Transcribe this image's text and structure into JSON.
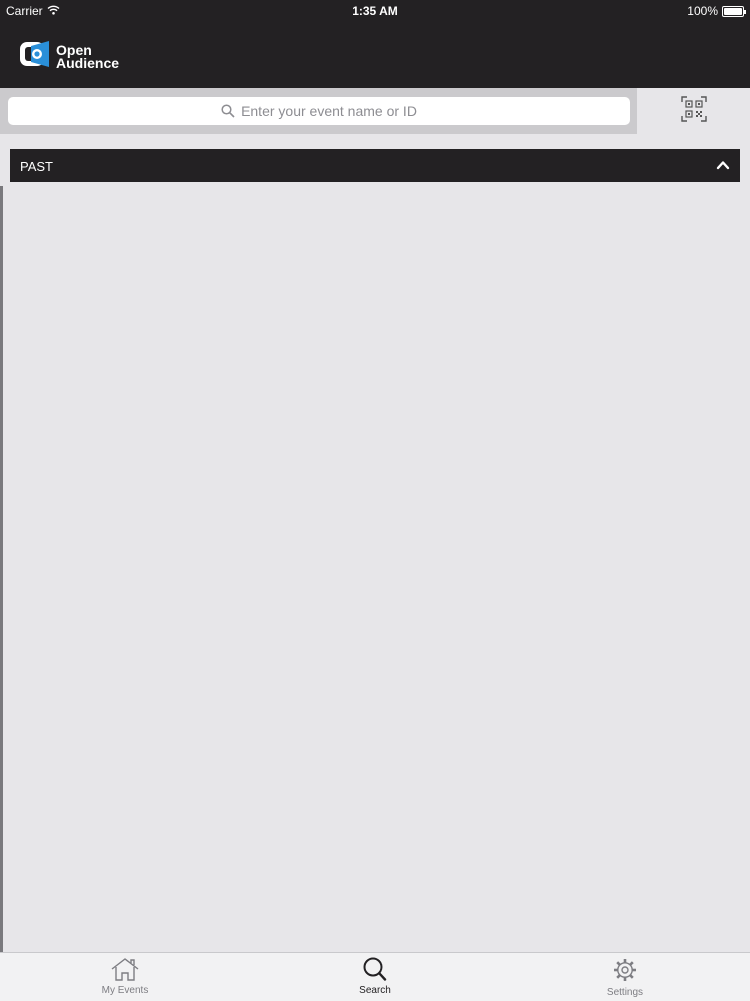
{
  "status_bar": {
    "carrier": "Carrier",
    "time": "1:35 AM",
    "battery": "100%"
  },
  "header": {
    "logo_line1": "Open",
    "logo_line2": "Audience"
  },
  "search": {
    "placeholder": "Enter your event name or ID",
    "qr_icon": "qr-code-icon"
  },
  "section": {
    "title": "PAST",
    "toggle_icon": "chevron-up-icon"
  },
  "tabs": [
    {
      "label": "My Events",
      "icon": "home-icon"
    },
    {
      "label": "Search",
      "icon": "search-icon"
    },
    {
      "label": "Settings",
      "icon": "gear-icon"
    }
  ],
  "colors": {
    "header_bg": "#232123",
    "content_bg": "#e7e6e9",
    "brand_blue": "#2a8fd8"
  }
}
